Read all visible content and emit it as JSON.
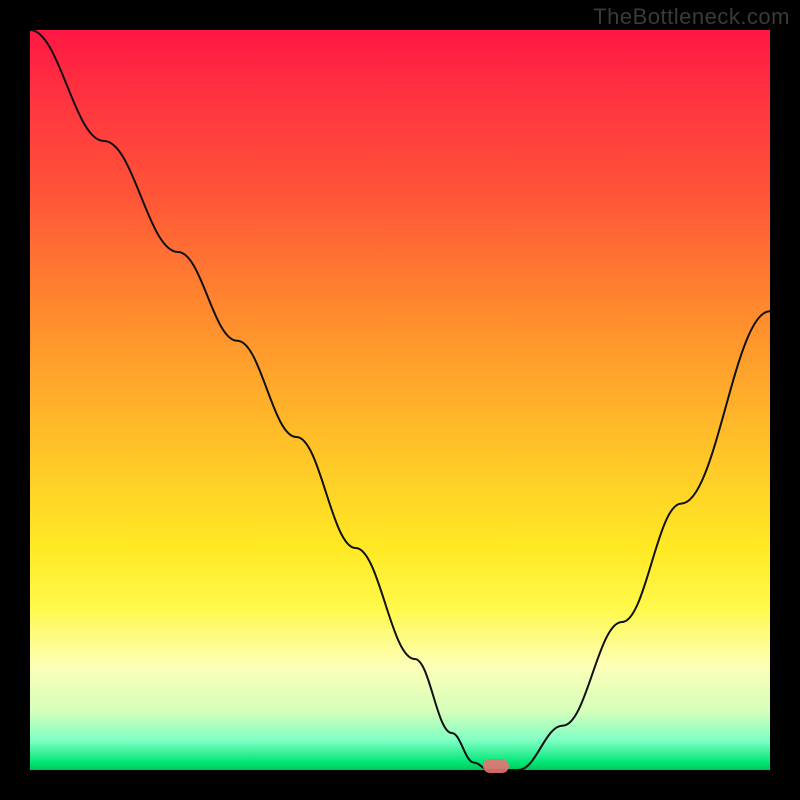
{
  "watermark": "TheBottleneck.com",
  "chart_data": {
    "type": "line",
    "title": "",
    "xlabel": "",
    "ylabel": "",
    "xlim": [
      0,
      100
    ],
    "ylim": [
      0,
      100
    ],
    "x": [
      0,
      10,
      20,
      28,
      36,
      44,
      52,
      57,
      60,
      62,
      66,
      72,
      80,
      88,
      100
    ],
    "values": [
      100,
      85,
      70,
      58,
      45,
      30,
      15,
      5,
      1,
      0,
      0,
      6,
      20,
      36,
      62
    ],
    "marker": {
      "x": 63,
      "y": 0
    },
    "gradient_stops": [
      {
        "pos": 0,
        "meaning": "worst",
        "color": "#ff1744"
      },
      {
        "pos": 50,
        "meaning": "mid",
        "color": "#ffd327"
      },
      {
        "pos": 100,
        "meaning": "best",
        "color": "#00c853"
      }
    ]
  }
}
